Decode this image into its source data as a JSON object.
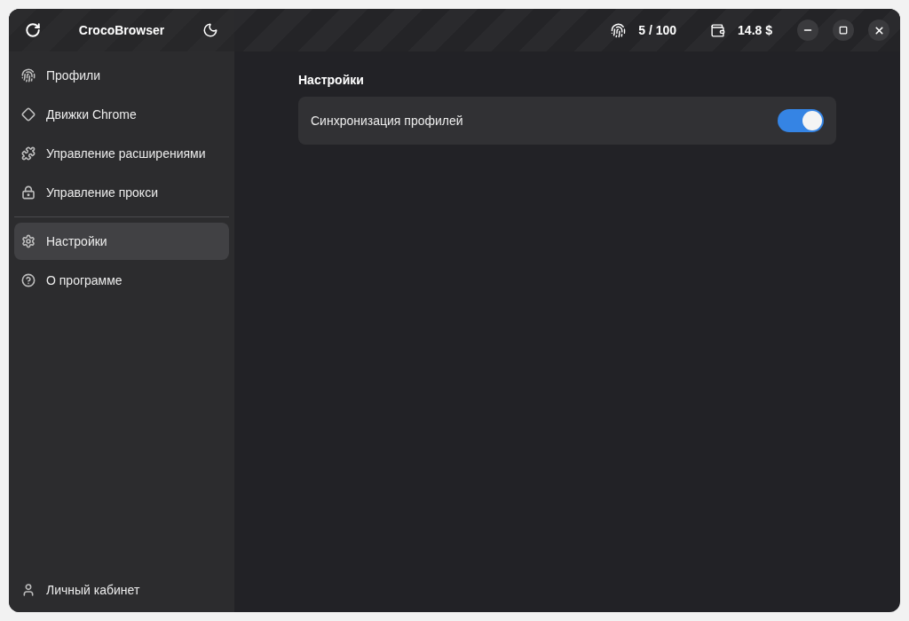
{
  "app": {
    "title": "CrocoBrowser"
  },
  "header": {
    "profiles_count": "5 / 100",
    "balance": "14.8 $"
  },
  "sidebar": {
    "items": [
      {
        "label": "Профили",
        "selected": false
      },
      {
        "label": "Движки Chrome",
        "selected": false
      },
      {
        "label": "Управление расширениями",
        "selected": false
      },
      {
        "label": "Управление прокси",
        "selected": false
      }
    ],
    "items_bottom": [
      {
        "label": "Настройки",
        "selected": true
      },
      {
        "label": "О программе",
        "selected": false
      }
    ],
    "footer_item": {
      "label": "Личный кабинет",
      "selected": false
    }
  },
  "settings": {
    "title": "Настройки",
    "options": [
      {
        "label": "Синхронизация профилей",
        "on": true
      }
    ]
  }
}
